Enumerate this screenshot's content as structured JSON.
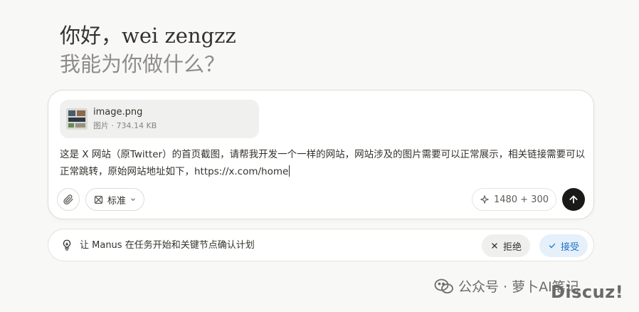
{
  "greeting": {
    "line1": "你好，wei zengzz",
    "line2": "我能为你做什么？"
  },
  "attachment": {
    "file_name": "image.png",
    "file_meta": "图片 · 734.14 KB"
  },
  "prompt": {
    "text": "这是 X 网站（原Twitter）的首页截图，请帮我开发一个一样的网站，网站涉及的图片需要可以正常展示，相关链接需要可以正常跳转，原始网站地址如下，https://x.com/home"
  },
  "toolbar": {
    "mode_label": "标准",
    "credits": "1480 + 300"
  },
  "confirm": {
    "text": "让 Manus 在任务开始和关键节点确认计划",
    "reject_label": "拒绝",
    "accept_label": "接受"
  },
  "watermark": {
    "text": "公众号 · 萝卜AI笔记",
    "discuz": "Discuz!"
  },
  "colors": {
    "background": "#f8f8f7",
    "accent_blue": "#1a73c8",
    "send_button": "#1a1a19"
  }
}
